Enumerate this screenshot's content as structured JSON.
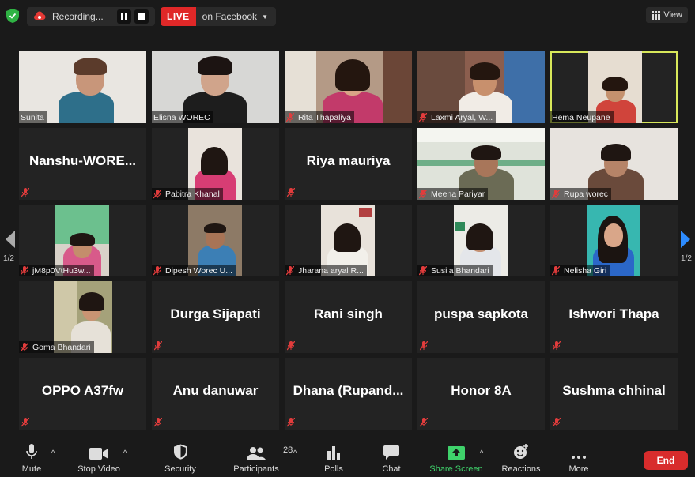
{
  "top_bar": {
    "recording_label": "Recording...",
    "live_label": "LIVE",
    "live_destination": "on Facebook",
    "view_label": "View"
  },
  "participants": [
    {
      "name": "Sunita",
      "video": true,
      "muted": false
    },
    {
      "name": "Elisna WOREC",
      "video": true,
      "muted": false
    },
    {
      "name": "Rita Thapaliya",
      "video": true,
      "muted": true
    },
    {
      "name": "Laxmi Aryal, W...",
      "video": true,
      "muted": true
    },
    {
      "name": "Hema Neupane",
      "video": true,
      "muted": false,
      "active_speaker": true
    },
    {
      "name": "Nanshu-WORE...",
      "video": false,
      "muted": true
    },
    {
      "name": "Pabitra Khanal",
      "video": true,
      "muted": true
    },
    {
      "name": "Riya mauriya",
      "video": false,
      "muted": true
    },
    {
      "name": "Meena Pariyar",
      "video": true,
      "muted": true
    },
    {
      "name": "Rupa worec",
      "video": true,
      "muted": true
    },
    {
      "name": "jM8p0VtHu3w...",
      "video": true,
      "muted": true
    },
    {
      "name": "Dipesh Worec U...",
      "video": true,
      "muted": true
    },
    {
      "name": "Jharana aryal R...",
      "video": true,
      "muted": true
    },
    {
      "name": "Susila Bhandari",
      "video": true,
      "muted": true
    },
    {
      "name": "Nelisha Giri",
      "video": true,
      "muted": true
    },
    {
      "name": "Goma Bhandari",
      "video": true,
      "muted": true
    },
    {
      "name": "Durga Sijapati",
      "video": false,
      "muted": true
    },
    {
      "name": "Rani singh",
      "video": false,
      "muted": true
    },
    {
      "name": "puspa sapkota",
      "video": false,
      "muted": true
    },
    {
      "name": "Ishwori Thapa",
      "video": false,
      "muted": true
    },
    {
      "name": "OPPO A37fw",
      "video": false,
      "muted": true
    },
    {
      "name": "Anu danuwar",
      "video": false,
      "muted": true
    },
    {
      "name": "Dhana  (Rupand...",
      "video": false,
      "muted": true
    },
    {
      "name": "Honor 8A",
      "video": false,
      "muted": true
    },
    {
      "name": "Sushma chhinal",
      "video": false,
      "muted": true
    }
  ],
  "pagination": {
    "left": "1/2",
    "right": "1/2"
  },
  "toolbar": {
    "mute": "Mute",
    "stop_video": "Stop Video",
    "security": "Security",
    "participants": "Participants",
    "participants_count": "28",
    "polls": "Polls",
    "chat": "Chat",
    "share_screen": "Share Screen",
    "reactions": "Reactions",
    "more": "More",
    "end": "End"
  },
  "colors": {
    "live": "#e02828",
    "active_speaker_border": "#d8e85a",
    "share_screen": "#3fd26b",
    "end": "#d82c2c",
    "page_arrow_active": "#2d8cff"
  }
}
